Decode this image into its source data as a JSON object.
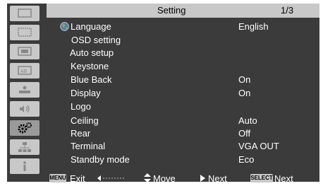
{
  "header": {
    "title": "Setting",
    "page": "1/3"
  },
  "menu": [
    {
      "label": "Language",
      "value": "English",
      "icon": "globe-icon"
    },
    {
      "label": "OSD setting",
      "value": ""
    },
    {
      "label": "Auto setup",
      "value": ""
    },
    {
      "label": "Keystone",
      "value": ""
    },
    {
      "label": "Blue Back",
      "value": "On"
    },
    {
      "label": "Display",
      "value": "On"
    },
    {
      "label": "Logo",
      "value": ""
    },
    {
      "label": "Ceiling",
      "value": "Auto"
    },
    {
      "label": "Rear",
      "value": "Off"
    },
    {
      "label": "Terminal",
      "value": "VGA OUT"
    },
    {
      "label": "Standby mode",
      "value": "Eco"
    }
  ],
  "sidebar": {
    "icons": [
      "monitor-icon",
      "pc-adjust-icon",
      "image-select-icon",
      "image-adjust-icon",
      "screen-icon",
      "sound-icon",
      "setting-gear-icon",
      "network-icon",
      "info-icon"
    ],
    "active_index": 6
  },
  "footer": {
    "menu_key": "MENU",
    "exit_label": "Exit",
    "move_label": "Move",
    "next_label": "Next",
    "select_key": "SELECT",
    "select_next_label": "Next"
  },
  "colors": {
    "background": "#3b3b3b",
    "header": "#c8c8c8",
    "text": "#ffffff"
  }
}
